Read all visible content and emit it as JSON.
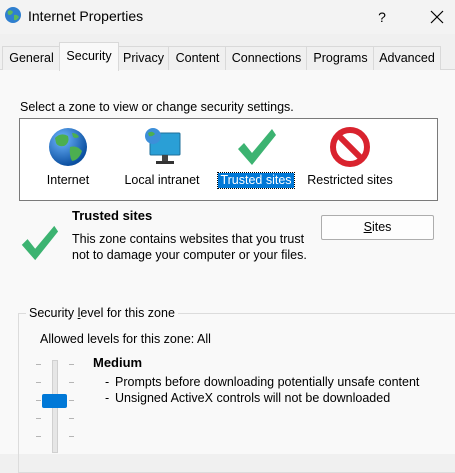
{
  "window": {
    "title": "Internet Properties",
    "help_label": "?"
  },
  "tabs": [
    {
      "label": "General"
    },
    {
      "label": "Security"
    },
    {
      "label": "Privacy"
    },
    {
      "label": "Content"
    },
    {
      "label": "Connections"
    },
    {
      "label": "Programs"
    },
    {
      "label": "Advanced"
    }
  ],
  "active_tab": "Security",
  "security": {
    "zone_prompt": "Select a zone to view or change security settings.",
    "zones": [
      {
        "label": "Internet",
        "icon": "globe-icon"
      },
      {
        "label": "Local intranet",
        "icon": "network-monitor-icon"
      },
      {
        "label": "Trusted sites",
        "icon": "green-checkmark-icon"
      },
      {
        "label": "Restricted sites",
        "icon": "no-entry-icon"
      }
    ],
    "selected_zone": "Trusted sites",
    "zone_title": "Trusted sites",
    "zone_description": "This zone contains websites that you trust not to damage your computer or your files.",
    "sites_button": {
      "pre": "",
      "accel": "S",
      "post": "ites"
    },
    "level_group": {
      "pre": "Security ",
      "accel": "l",
      "post": "evel for this zone"
    },
    "allowed_levels": "Allowed levels for this zone: All",
    "level_name": "Medium",
    "level_bullets": [
      "Prompts before downloading potentially unsafe content",
      "Unsigned ActiveX controls will not be downloaded"
    ]
  },
  "colors": {
    "accent": "#0078d7",
    "check_green": "#3cb371",
    "restricted_red": "#d9232e"
  }
}
